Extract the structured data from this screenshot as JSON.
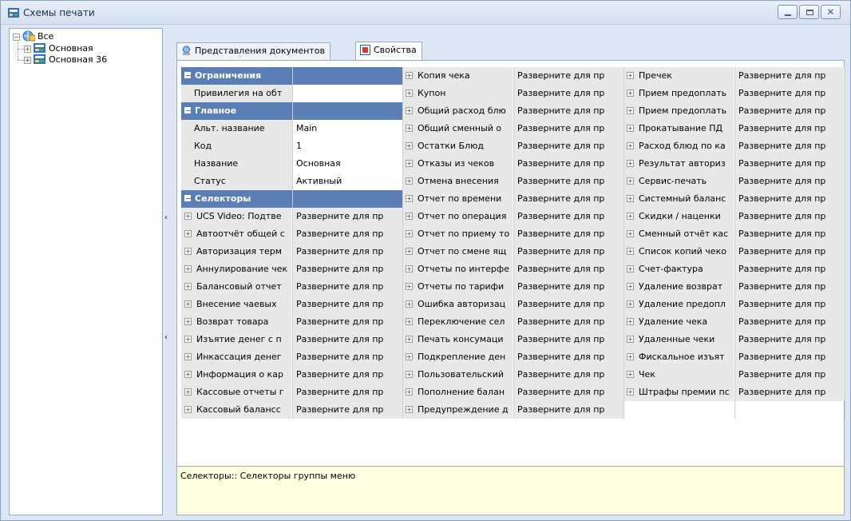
{
  "window": {
    "title": "Схемы печати"
  },
  "tree": {
    "root": {
      "label": "Все"
    },
    "children": [
      {
        "label": "Основная"
      },
      {
        "label": "Основная 36"
      }
    ]
  },
  "tabs": [
    {
      "label": "Представления документов",
      "icon": "document-view-icon"
    },
    {
      "label": "Свойства",
      "icon": "properties-icon"
    }
  ],
  "properties": {
    "groups": {
      "restrictions": {
        "label": "Ограничения"
      },
      "main": {
        "label": "Главное"
      },
      "selectors": {
        "label": "Селекторы"
      }
    },
    "restrictions_rows": [
      {
        "name": "Привилегия на обт",
        "value": ""
      }
    ],
    "main_rows": [
      {
        "name": "Альт. название",
        "value": "Main"
      },
      {
        "name": "Код",
        "value": "1"
      },
      {
        "name": "Название",
        "value": "Основная"
      },
      {
        "name": "Статус",
        "value": "Активный"
      }
    ],
    "col1_selectors": [
      {
        "name": "UCS Video: Подтве",
        "value": "Разверните для пр"
      },
      {
        "name": "Автоотчёт общей с",
        "value": "Разверните для пр"
      },
      {
        "name": "Авторизация терм",
        "value": "Разверните для пр"
      },
      {
        "name": "Аннулирование чек",
        "value": "Разверните для пр"
      },
      {
        "name": "Балансовый отчет",
        "value": "Разверните для пр"
      },
      {
        "name": "Внесение чаевых",
        "value": "Разверните для пр"
      },
      {
        "name": "Возврат товара",
        "value": "Разверните для пр"
      },
      {
        "name": "Изъятие денег с п",
        "value": "Разверните для пр"
      },
      {
        "name": "Инкассация денег",
        "value": "Разверните для пр"
      },
      {
        "name": "Информация о кар",
        "value": "Разверните для пр"
      },
      {
        "name": "Кассовые отчеты г",
        "value": "Разверните для пр"
      },
      {
        "name": "Кассовый балансс",
        "value": "Разверните для пр"
      }
    ],
    "col2_selectors": [
      {
        "name": "Копия чека",
        "value": "Разверните для пр"
      },
      {
        "name": "Купон",
        "value": "Разверните для пр"
      },
      {
        "name": "Общий расход блю",
        "value": "Разверните для пр"
      },
      {
        "name": "Общий сменный о",
        "value": "Разверните для пр"
      },
      {
        "name": "Остатки Блюд",
        "value": "Разверните для пр"
      },
      {
        "name": "Отказы из чеков",
        "value": "Разверните для пр"
      },
      {
        "name": "Отмена внесения",
        "value": "Разверните для пр"
      },
      {
        "name": "Отчет по времени",
        "value": "Разверните для пр"
      },
      {
        "name": "Отчет по операция",
        "value": "Разверните для пр"
      },
      {
        "name": "Отчет по приему то",
        "value": "Разверните для пр"
      },
      {
        "name": "Отчет по смене ящ",
        "value": "Разверните для пр"
      },
      {
        "name": "Отчеты по интерфе",
        "value": "Разверните для пр"
      },
      {
        "name": "Отчеты по тарифи",
        "value": "Разверните для пр"
      },
      {
        "name": "Ошибка авторизац",
        "value": "Разверните для пр"
      },
      {
        "name": "Переключение сел",
        "value": "Разверните для пр"
      },
      {
        "name": "Печать консумаци",
        "value": "Разверните для пр"
      },
      {
        "name": "Подкрепление ден",
        "value": "Разверните для пр"
      },
      {
        "name": "Пользовательский",
        "value": "Разверните для пр"
      },
      {
        "name": "Пополнение балан",
        "value": "Разверните для пр"
      },
      {
        "name": "Предупреждение д",
        "value": "Разверните для пр"
      }
    ],
    "col3_selectors": [
      {
        "name": "Пречек",
        "value": "Разверните для пр"
      },
      {
        "name": "Прием предоплать",
        "value": "Разверните для пр"
      },
      {
        "name": "Прием предоплать",
        "value": "Разверните для пр"
      },
      {
        "name": "Прокатывание ПД",
        "value": "Разверните для пр"
      },
      {
        "name": "Расход блюд по ка",
        "value": "Разверните для пр"
      },
      {
        "name": "Результат авториз",
        "value": "Разверните для пр"
      },
      {
        "name": "Сервис-печать",
        "value": "Разверните для пр"
      },
      {
        "name": "Системный баланс",
        "value": "Разверните для пр"
      },
      {
        "name": "Скидки / наценки",
        "value": "Разверните для пр"
      },
      {
        "name": "Сменный отчёт кас",
        "value": "Разверните для пр"
      },
      {
        "name": "Список копий чеко",
        "value": "Разверните для пр"
      },
      {
        "name": "Счет-фактура",
        "value": "Разверните для пр"
      },
      {
        "name": "Удаление возврат",
        "value": "Разверните для пр"
      },
      {
        "name": "Удаление предопл",
        "value": "Разверните для пр"
      },
      {
        "name": "Удаление чека",
        "value": "Разверните для пр"
      },
      {
        "name": "Удаленные чеки",
        "value": "Разверните для пр"
      },
      {
        "name": "Фискальное изъят",
        "value": "Разверните для пр"
      },
      {
        "name": "Чек",
        "value": "Разверните для пр"
      },
      {
        "name": "Штрафы премии пс",
        "value": "Разверните для пр"
      }
    ]
  },
  "description": {
    "text": "Селекторы:: Селекторы группы меню"
  },
  "colors": {
    "category_header": "#5b7fb5",
    "description_bg": "#fffee0"
  }
}
